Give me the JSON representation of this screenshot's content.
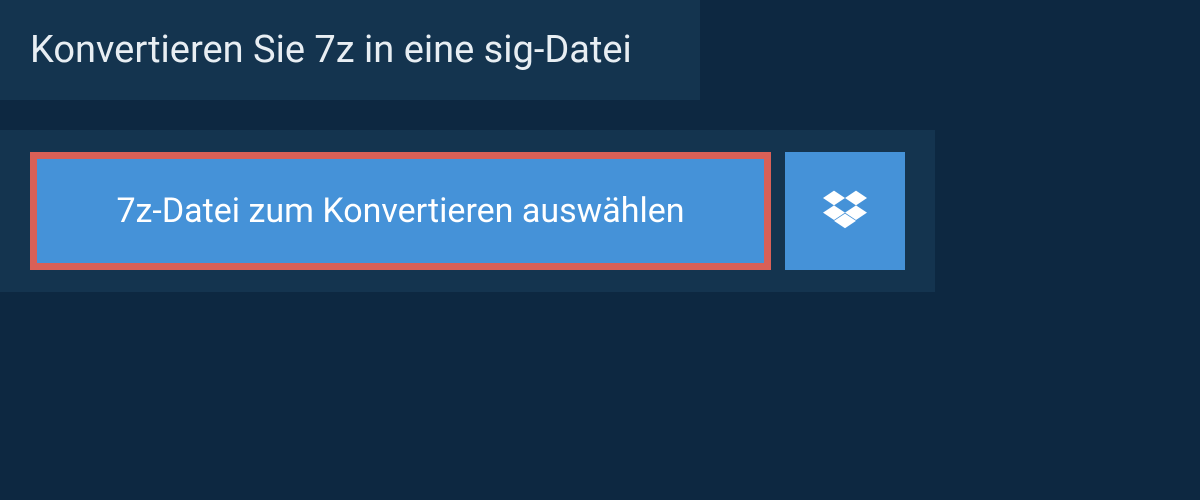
{
  "header": {
    "title": "Konvertieren Sie 7z in eine sig-Datei"
  },
  "buttons": {
    "select_file_label": "7z-Datei zum Konvertieren auswählen",
    "dropbox_icon": "dropbox"
  },
  "colors": {
    "background": "#0d2841",
    "panel": "#14344f",
    "button_primary": "#4592d8",
    "highlight_border": "#d96057",
    "text_light": "#e8eef3",
    "text_white": "#ffffff"
  }
}
